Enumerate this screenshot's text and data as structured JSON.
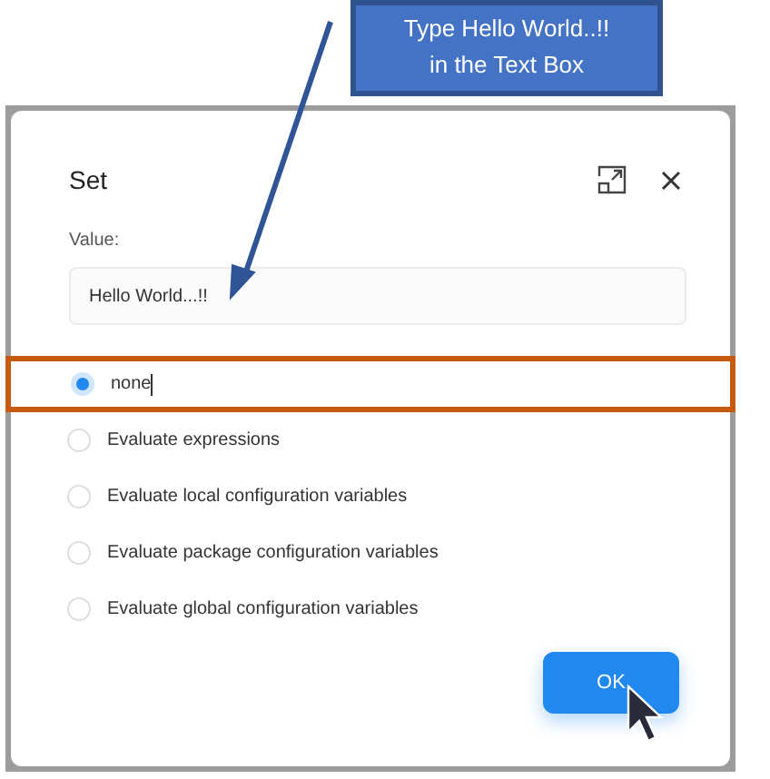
{
  "callout": {
    "text": "Type Hello World..!!\nin the Text Box"
  },
  "dialog": {
    "title": "Set",
    "value_label": "Value:",
    "value": "Hello World...!!",
    "options": [
      {
        "label": "none",
        "selected": true,
        "highlighted": true,
        "text_cursor": true
      },
      {
        "label": "Evaluate expressions",
        "selected": false,
        "highlighted": false,
        "text_cursor": false
      },
      {
        "label": "Evaluate local configuration variables",
        "selected": false,
        "highlighted": false,
        "text_cursor": false
      },
      {
        "label": "Evaluate package configuration variables",
        "selected": false,
        "highlighted": false,
        "text_cursor": false
      },
      {
        "label": "Evaluate global configuration variables",
        "selected": false,
        "highlighted": false,
        "text_cursor": false
      }
    ],
    "ok_button": "OK"
  }
}
